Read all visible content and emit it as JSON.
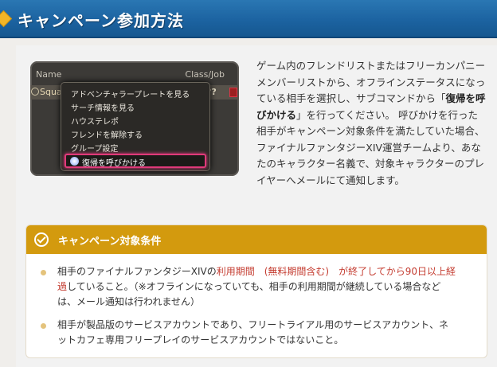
{
  "header": {
    "title": "キャンペーン参加方法"
  },
  "game_screenshot": {
    "col_name": "Name",
    "col_class": "Class/Job",
    "row_name": "Squa",
    "row_question": "??",
    "menu_items": [
      "アドベンチャラープレートを見る",
      "サーチ情報を見る",
      "ハウステレポ",
      "フレンドを解除する",
      "グループ設定"
    ],
    "highlighted_item": "復帰を呼びかける"
  },
  "description": {
    "part1": "ゲーム内のフレンドリストまたはフリーカンパニーメンバーリストから、オフラインステータスになっている相手を選択し、サブコマンドから「",
    "bold": "復帰を呼びかける",
    "part2": "」を行ってください。 呼びかけを行った相手がキャンペーン対象条件を満たしていた場合、ファイナルファンタジーXIV運営チームより、あなたのキャラクター名義で、対象キャラクターのプレイヤーへメールにて通知します。"
  },
  "conditions": {
    "title": "キャンペーン対象条件",
    "item1_a": "相手のファイナルファンタジーXIVの",
    "item1_red": "利用期間　(無料期間含む)　が終了してから90日以上経過",
    "item1_b": "していること。（※オフラインになっていても、相手の利用期間が継続している場合などは、メール通知は行われません）",
    "item2": "相手が製品版のサービスアカウントであり、フリートライアル用のサービスアカウント、ネットカフェ専用フリープレイのサービスアカウントではないこと。"
  }
}
